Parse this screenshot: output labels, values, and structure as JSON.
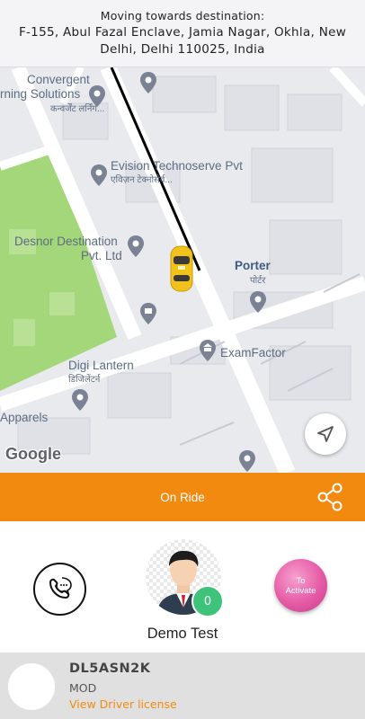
{
  "destination": {
    "title": "Moving towards destination:",
    "address": "F-155, Abul Fazal Enclave, Jamia Nagar, Okhla, New Delhi, Delhi 110025, India"
  },
  "map": {
    "labels": {
      "convergent": "Convergent",
      "convergent_line2": "rning Solutions",
      "convergent_hindi": "कन्वर्जेंट लर्निंग...",
      "evision": "Evision Technoserve Pvt",
      "evision_hindi": "एविज़न टेक्नोसेर्व...",
      "desnor": "Desnor Destination",
      "desnor_line2": "Pvt. Ltd",
      "porter": "Porter",
      "porter_hindi": "पोर्टर",
      "examfactor": "ExamFactor",
      "digi": "Digi Lantern",
      "digi_hindi": "डिजिलेंटर्न",
      "apparels": "Apparels"
    },
    "attribution": "Google",
    "park_color": "#a4d77a",
    "route_color": "#000000"
  },
  "status": {
    "label": "On Ride",
    "bar_color": "#f28a10"
  },
  "driver": {
    "name": "Demo Test",
    "badge_count": "0",
    "activate_label": "To Activate"
  },
  "vehicle": {
    "plate": "DL5ASN2K",
    "model": "MOD",
    "license_link": "View Driver license"
  },
  "icons": [
    "map-pin-icon",
    "locate-icon",
    "share-icon",
    "phone-chat-icon",
    "taxi-car-icon",
    "camera-pin-icon",
    "bank-pin-icon"
  ]
}
